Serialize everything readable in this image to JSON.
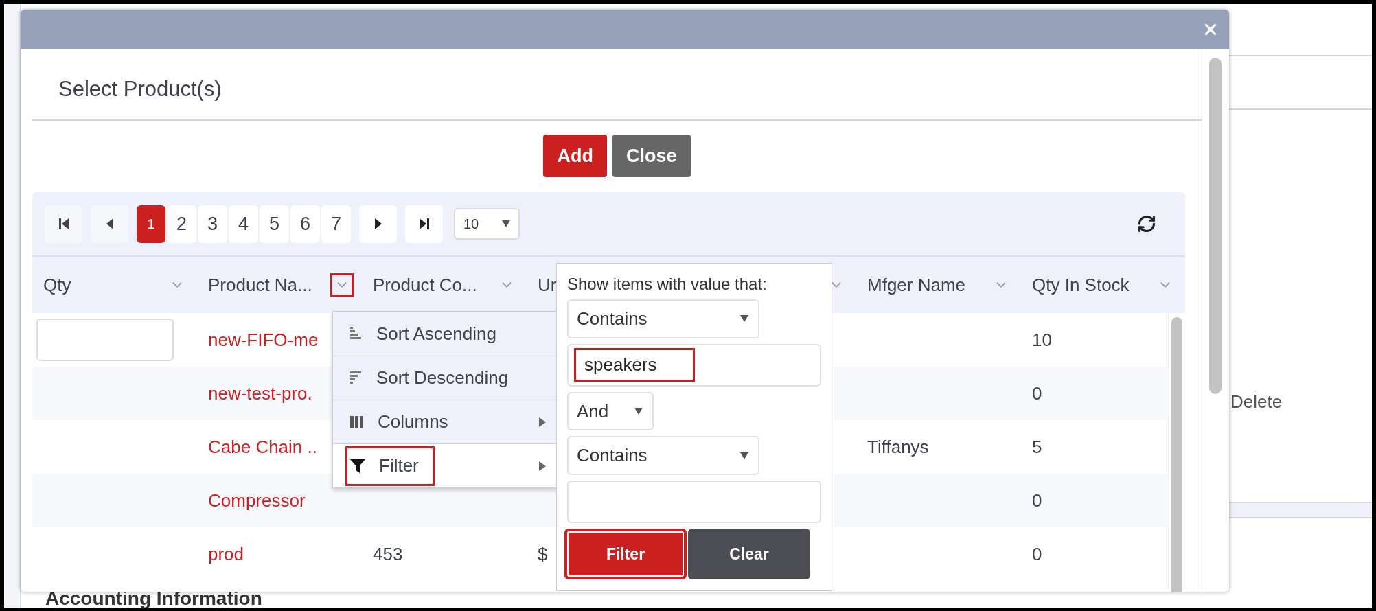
{
  "background": {
    "action": "Delete",
    "section_title": "Accounting Information"
  },
  "modal": {
    "title": "Select Product(s)",
    "buttons": [
      {
        "label": "Add",
        "kind": "primary"
      },
      {
        "label": "Close",
        "kind": "secondary"
      }
    ]
  },
  "pager": {
    "pages": [
      {
        "label": "1",
        "selected": true
      },
      {
        "label": "2",
        "selected": false
      },
      {
        "label": "3",
        "selected": false
      },
      {
        "label": "4",
        "selected": false
      },
      {
        "label": "5",
        "selected": false
      },
      {
        "label": "6",
        "selected": false
      },
      {
        "label": "7",
        "selected": false
      }
    ],
    "page_size": "10"
  },
  "grid": {
    "columns": [
      {
        "label": "Qty",
        "highlighted": false
      },
      {
        "label": "Product Na...",
        "highlighted": true
      },
      {
        "label": "Product Co...",
        "highlighted": false
      },
      {
        "label": "Ur"
      },
      {
        "highlighted": false
      },
      {
        "label": "Mfger Name",
        "highlighted": false
      },
      {
        "label": "Qty In Stock",
        "highlighted": false
      }
    ],
    "rows": [
      {
        "qty_field": true,
        "product_name": "new-FIFO-me",
        "qty_in_stock": "10"
      },
      {
        "qty_field": false,
        "product_name": "new-test-pro.",
        "qty_in_stock": "0"
      },
      {
        "qty_field": false,
        "product_name": "Cabe Chain ..",
        "mfger_name": "Tiffanys",
        "qty_in_stock": "5"
      },
      {
        "qty_field": false,
        "product_name": "Compressor",
        "qty_in_stock": "0"
      },
      {
        "qty_field": false,
        "product_name": "prod",
        "product_code": "453",
        "column_4": "$",
        "qty_in_stock": "0"
      }
    ]
  },
  "column_menu": {
    "items": [
      {
        "kind": "sort_ascending",
        "label": "Sort Ascending",
        "highlighted": false
      },
      {
        "kind": "sort_descending",
        "label": "Sort Descending",
        "highlighted": false
      },
      {
        "kind": "columns",
        "label": "Columns",
        "highlighted": false
      },
      {
        "kind": "filter",
        "label": "Filter",
        "highlighted": true
      }
    ]
  },
  "filter_panel": {
    "prompt": "Show items with value that:",
    "operator_1": "Contains",
    "value_1": "speakers",
    "value_1_highlighted": true,
    "logic": "And",
    "operator_2": "Contains",
    "buttons": [
      {
        "label": "Filter",
        "kind": "primary",
        "highlighted": true
      },
      {
        "label": "Clear",
        "kind": "secondary",
        "highlighted": false
      }
    ]
  }
}
